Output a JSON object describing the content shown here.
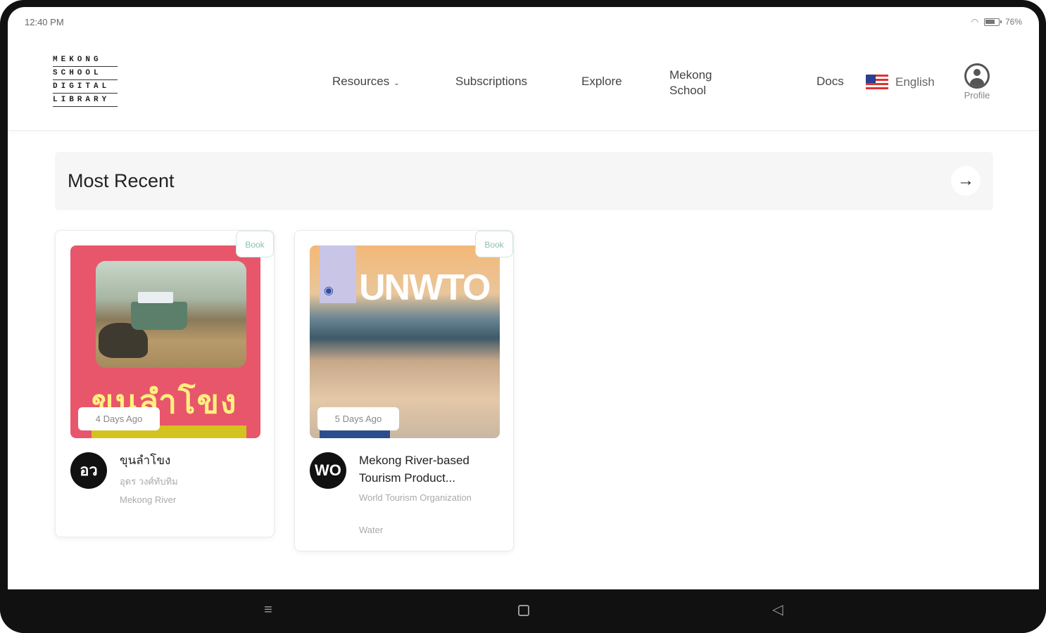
{
  "status_bar": {
    "time": "12:40 PM",
    "battery": "76%"
  },
  "logo": {
    "rows": [
      "MEKONG",
      "SCHOOL",
      "DIGITAL",
      "LIBRARY"
    ]
  },
  "nav": {
    "resources": "Resources",
    "subscriptions": "Subscriptions",
    "explore": "Explore",
    "mekong_school": "Mekong School",
    "docs": "Docs",
    "language": "English",
    "profile": "Profile"
  },
  "section": {
    "title": "Most Recent"
  },
  "cards": [
    {
      "badge": "Book",
      "time": "4 Days Ago",
      "avatar": "อว",
      "title": "ขุนลำโขง",
      "author": "อุดร วงศ์ทับทิม",
      "tag": "Mekong River",
      "cover_text": "ขุนลำโขง"
    },
    {
      "badge": "Book",
      "time": "5 Days Ago",
      "avatar": "WO",
      "title": "Mekong River-based Tourism Product...",
      "author": "World Tourism Organization",
      "tag": "Water",
      "cover_text": "UNWTO"
    }
  ],
  "system_nav": {
    "menu": "≡",
    "back": "◁"
  },
  "colors": {
    "badge_text": "#8bbfb5",
    "cover1": "#e8566b",
    "avatar_bg": "#111111"
  }
}
